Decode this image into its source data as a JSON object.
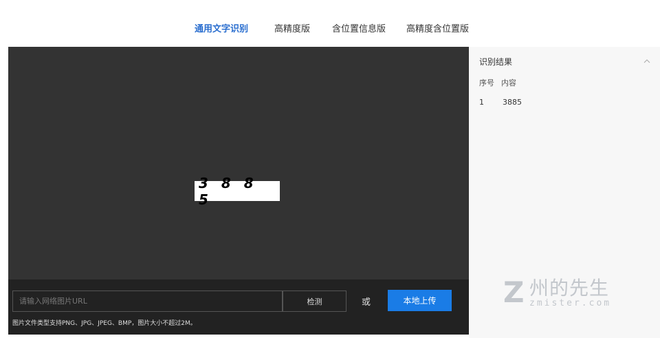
{
  "tabs": [
    {
      "label": "通用文字识别",
      "active": true
    },
    {
      "label": "高精度版",
      "active": false
    },
    {
      "label": "含位置信息版",
      "active": false
    },
    {
      "label": "高精度含位置版",
      "active": false
    }
  ],
  "viewer": {
    "image_text": "3 8 8 5"
  },
  "controls": {
    "url_placeholder": "请输入网络图片URL",
    "detect_label": "检测",
    "or_label": "或",
    "upload_label": "本地上传",
    "hint": "图片文件类型支持PNG、JPG、JPEG、BMP，图片大小不超过2M。"
  },
  "results": {
    "title": "识别结果",
    "columns": {
      "seq": "序号",
      "content": "内容"
    },
    "rows": [
      {
        "seq": "1",
        "content": "3885"
      }
    ],
    "collapse_icon": "chevron-up-icon"
  },
  "watermark": {
    "cn": "州的先生",
    "en": "zmister.com",
    "letter": "Z"
  },
  "colors": {
    "accent": "#1a7ce6",
    "active_tab": "#2a6ecf",
    "viewer_bg": "#333333",
    "controls_bg": "#222222",
    "panel_bg": "#f7f7f7"
  }
}
